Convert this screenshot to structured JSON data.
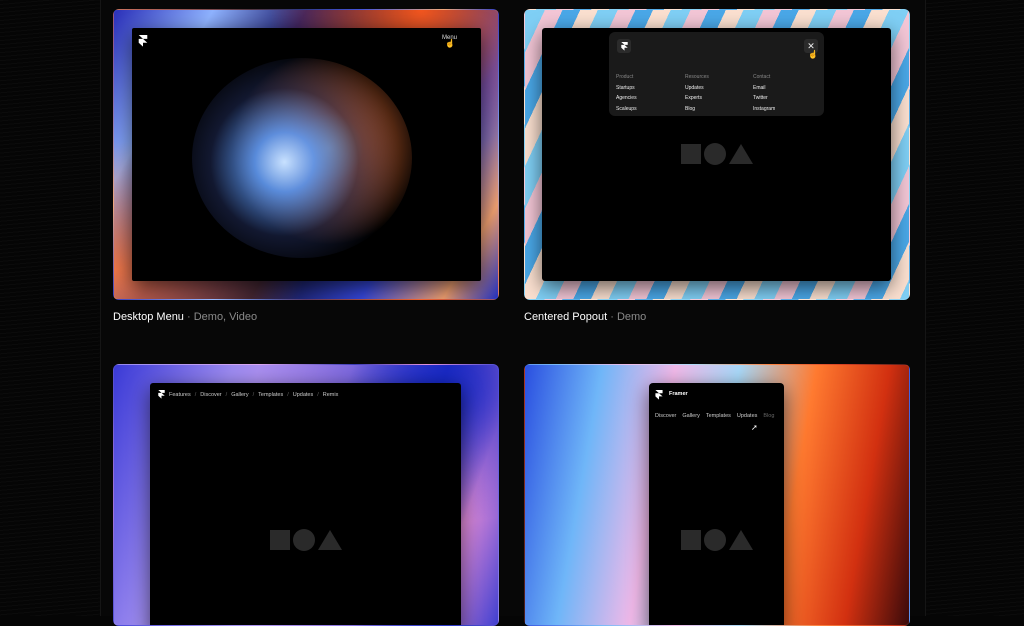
{
  "cards": [
    {
      "title": "Desktop Menu",
      "meta": "· Demo, Video",
      "menu_label": "Menu"
    },
    {
      "title": "Centered Popout",
      "meta": "· Demo",
      "popout": {
        "columns": [
          {
            "heading": "Product",
            "items": [
              "Startups",
              "Agencies",
              "Scaleups"
            ]
          },
          {
            "heading": "Resources",
            "items": [
              "Updates",
              "Experts",
              "Blog"
            ]
          },
          {
            "heading": "Contact",
            "items": [
              "Email",
              "Twitter",
              "Instagram"
            ]
          }
        ],
        "close_icon": "✕"
      }
    },
    {
      "nav": [
        "Features",
        "Discover",
        "Gallery",
        "Templates",
        "Updates",
        "Remix"
      ],
      "separator": "/"
    },
    {
      "brand": "Framer",
      "nav": [
        "Discover",
        "Gallery",
        "Templates",
        "Updates",
        "Blog"
      ]
    }
  ],
  "colors": {
    "background": "#050505",
    "meta_text": "#8a8a8a",
    "shape_fill": "#2a2a2a"
  },
  "icons": [
    "framer-logo-icon",
    "cursor-icon",
    "close-icon",
    "square-circle-triangle-icon"
  ]
}
